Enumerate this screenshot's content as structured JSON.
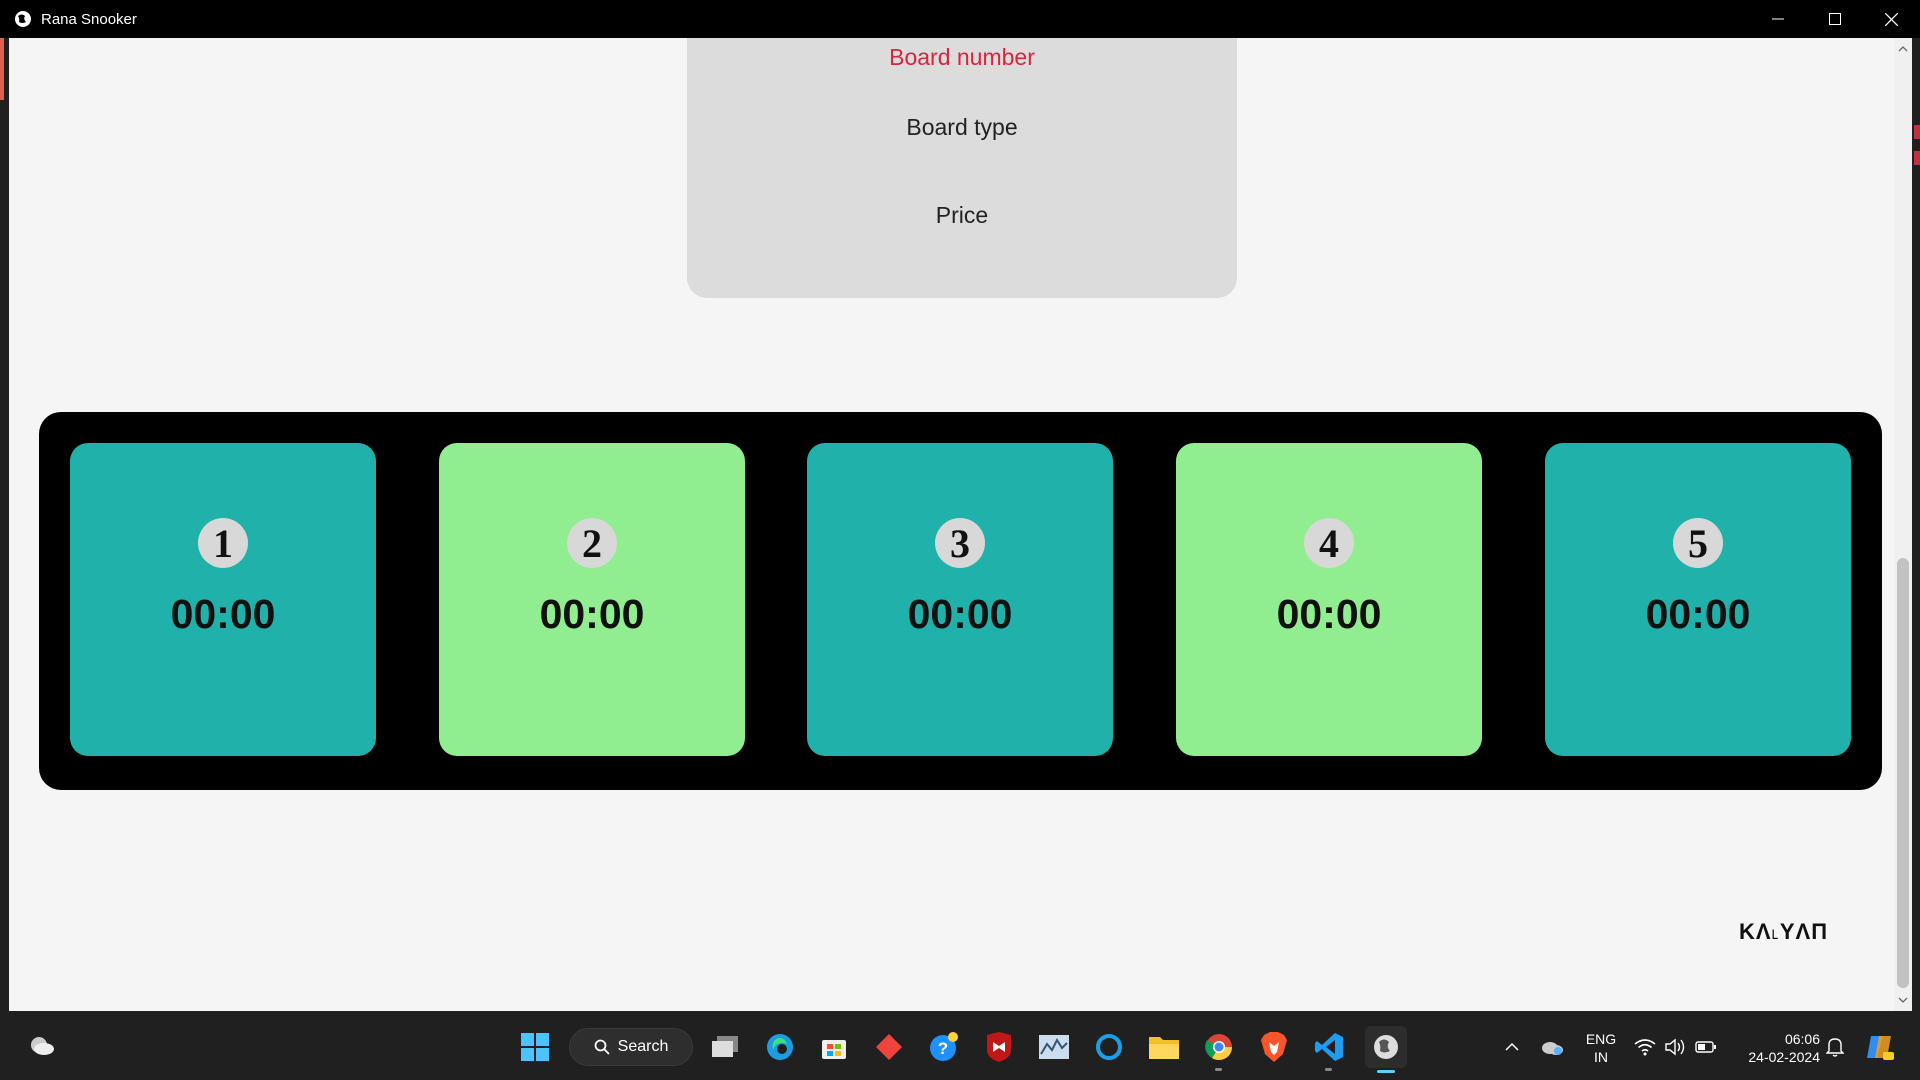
{
  "window": {
    "title": "Rana Snooker"
  },
  "form": {
    "board_number_label": "Board number",
    "board_type_label": "Board type",
    "price_label": "Price"
  },
  "boards": [
    {
      "number": "1",
      "timer": "00:00",
      "color": "#20b2aa"
    },
    {
      "number": "2",
      "timer": "00:00",
      "color": "#90ee90"
    },
    {
      "number": "3",
      "timer": "00:00",
      "color": "#20b2aa"
    },
    {
      "number": "4",
      "timer": "00:00",
      "color": "#90ee90"
    },
    {
      "number": "5",
      "timer": "00:00",
      "color": "#20b2aa"
    }
  ],
  "brand": {
    "text": "KΛ˪YΛП"
  },
  "taskbar": {
    "search_label": "Search",
    "language_line1": "ENG",
    "language_line2": "IN",
    "time": "06:06",
    "date": "24-02-2024",
    "pinned_icons": [
      "start-icon",
      "search-icon",
      "task-view-icon",
      "edge-icon",
      "store-icon",
      "anydesk-icon",
      "help-icon",
      "mcafee-icon",
      "monitor-icon",
      "cortana-icon",
      "file-explorer-icon",
      "chrome-icon",
      "brave-icon",
      "vscode-icon",
      "app-globe-icon"
    ]
  },
  "colors": {
    "teal_board": "#20b2aa",
    "green_board": "#90ee90",
    "panel": "#000000",
    "accent_red": "#d8253d"
  }
}
